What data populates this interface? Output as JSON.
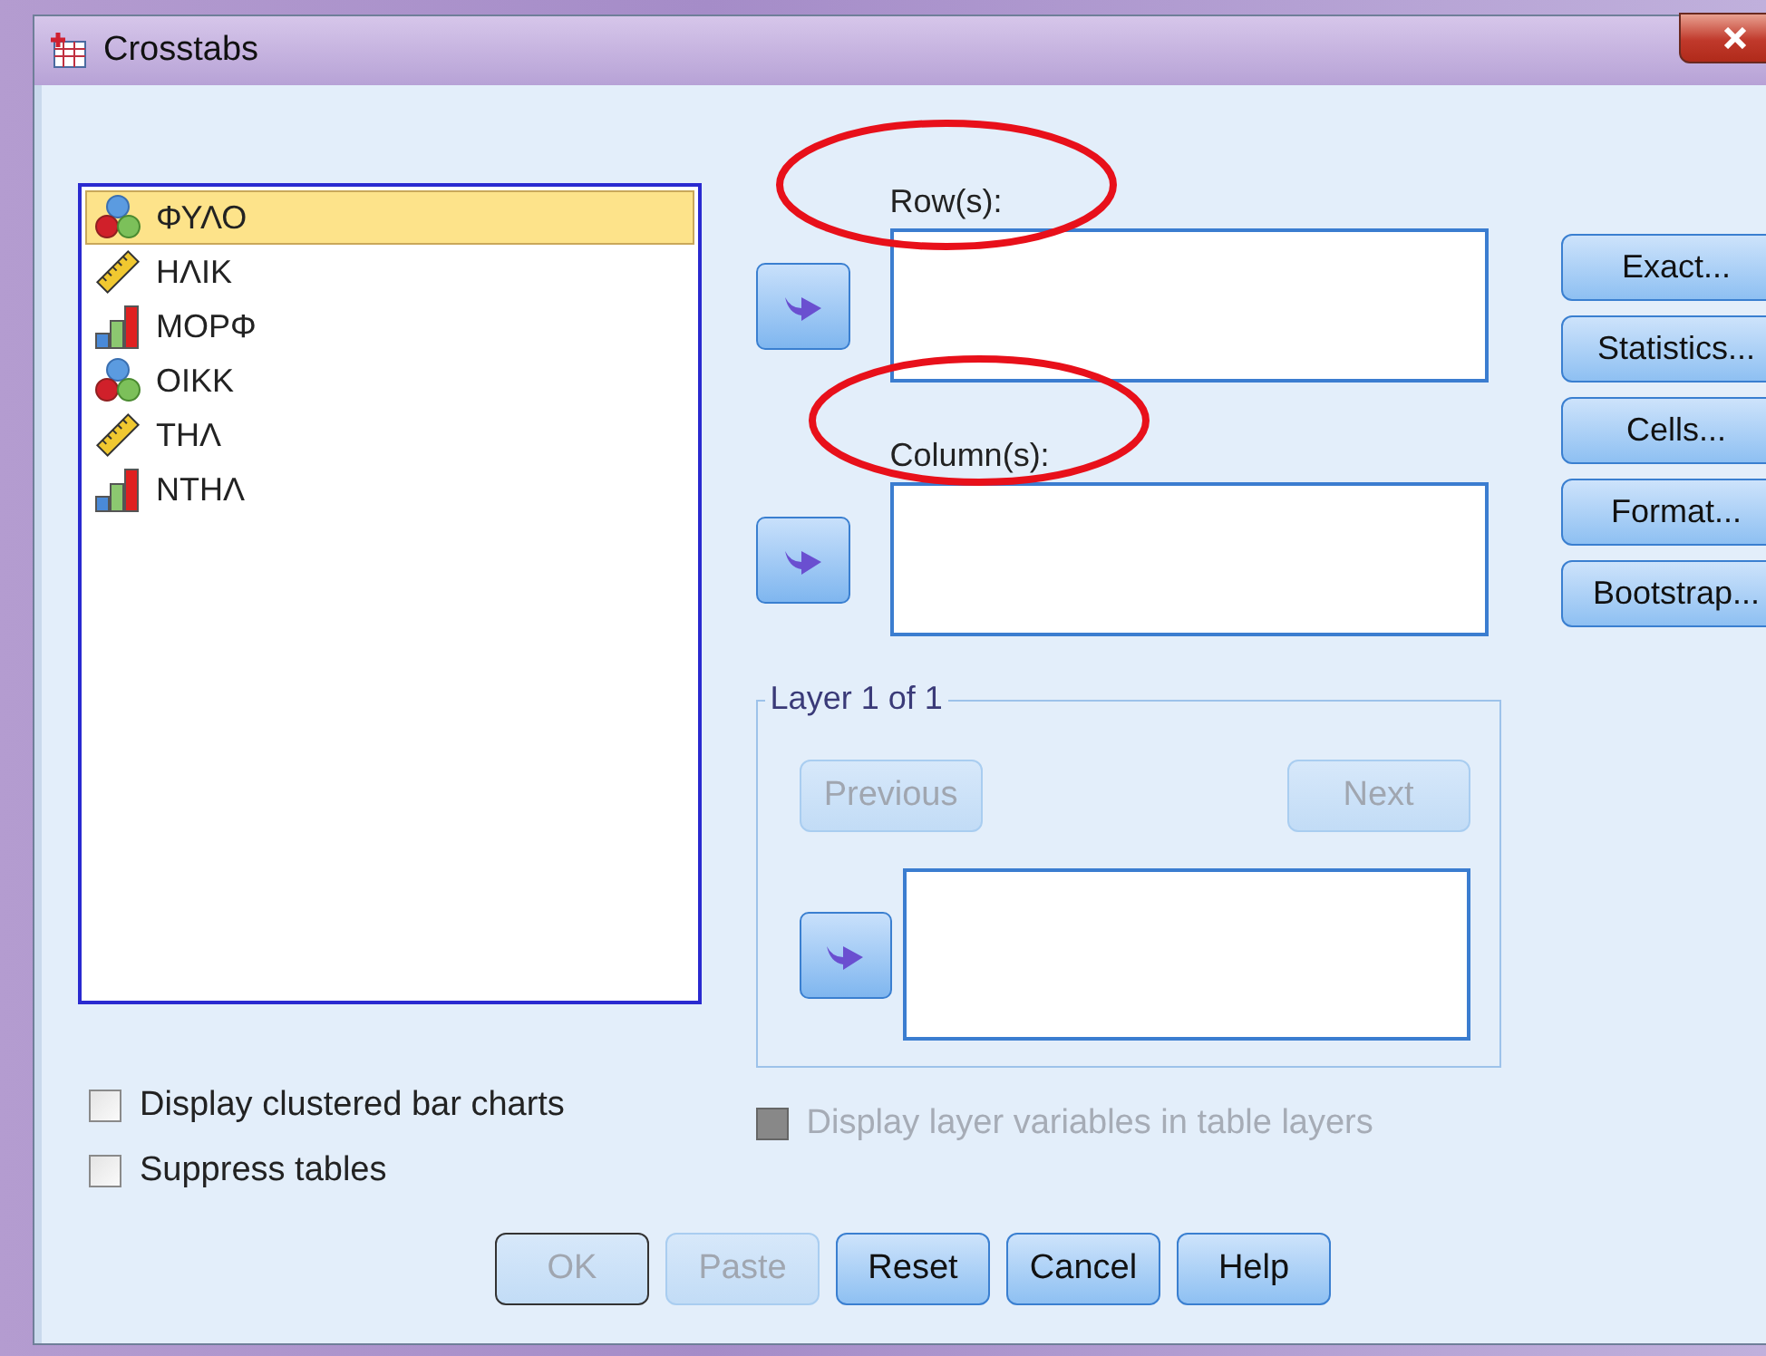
{
  "window": {
    "title": "Crosstabs"
  },
  "variables": [
    {
      "name": "ΦΥΛΟ",
      "kind": "nominal",
      "selected": true
    },
    {
      "name": "ΗΛΙΚ",
      "kind": "scale",
      "selected": false
    },
    {
      "name": "ΜΟΡΦ",
      "kind": "ordinal",
      "selected": false
    },
    {
      "name": "ΟΙΚΚ",
      "kind": "nominal",
      "selected": false
    },
    {
      "name": "ΤΗΛ",
      "kind": "scale",
      "selected": false
    },
    {
      "name": "ΝΤΗΛ",
      "kind": "ordinal",
      "selected": false
    }
  ],
  "targets": [
    {
      "label": "Row(s):",
      "highlighted": true
    },
    {
      "label": "Column(s):",
      "highlighted": true
    }
  ],
  "layer": {
    "title": "Layer 1 of 1",
    "previous": {
      "label": "Previous",
      "disabled": true
    },
    "next": {
      "label": "Next",
      "disabled": true
    }
  },
  "display_layer_variables": {
    "label": "Display layer variables in table layers",
    "checked": false,
    "disabled": true
  },
  "options": [
    {
      "label": "Display clustered bar charts",
      "checked": false
    },
    {
      "label": "Suppress tables",
      "checked": false
    }
  ],
  "side_buttons": [
    "Exact...",
    "Statistics...",
    "Cells...",
    "Format...",
    "Bootstrap..."
  ],
  "buttons": [
    {
      "label": "OK",
      "disabled": true,
      "default": true
    },
    {
      "label": "Paste",
      "disabled": true,
      "default": false
    },
    {
      "label": "Reset",
      "disabled": false,
      "default": false
    },
    {
      "label": "Cancel",
      "disabled": false,
      "default": false
    },
    {
      "label": "Help",
      "disabled": false,
      "default": false
    }
  ]
}
